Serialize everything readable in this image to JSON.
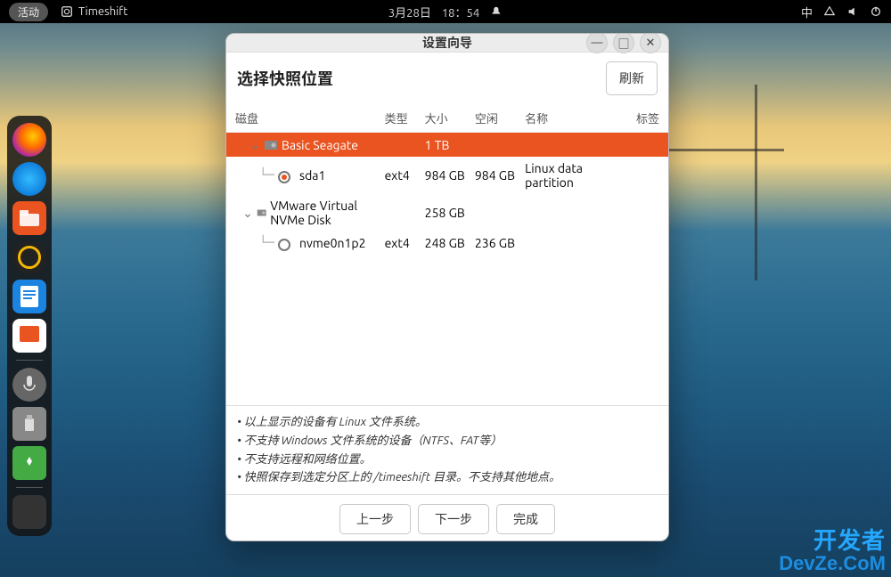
{
  "topbar": {
    "activities": "活动",
    "app_name": "Timeshift",
    "date": "3月28日",
    "time": "18：54",
    "input_method": "中"
  },
  "dock": {
    "items": [
      {
        "name": "firefox"
      },
      {
        "name": "thunderbird"
      },
      {
        "name": "files"
      },
      {
        "name": "rhythmbox"
      },
      {
        "name": "libreoffice-writer"
      },
      {
        "name": "ubuntu-software"
      },
      {
        "name": "microphone"
      },
      {
        "name": "usb-drive"
      },
      {
        "name": "recycle"
      },
      {
        "name": "show-apps"
      }
    ]
  },
  "window": {
    "title": "设置向导",
    "heading": "选择快照位置",
    "refresh": "刷新",
    "columns": {
      "disk": "磁盘",
      "type": "类型",
      "size": "大小",
      "free": "空闲",
      "name": "名称",
      "label": "标签"
    },
    "rows": [
      {
        "kind": "parent",
        "selected": true,
        "expanded": true,
        "label": "Basic Seagate",
        "type": "",
        "size": "1 TB",
        "free": "",
        "name": ""
      },
      {
        "kind": "child",
        "radio": true,
        "label": "sda1",
        "type": "ext4",
        "size": "984 GB",
        "free": "984 GB",
        "name": "Linux data partition"
      },
      {
        "kind": "parent",
        "selected": false,
        "expanded": true,
        "label": "VMware Virtual NVMe Disk",
        "type": "",
        "size": "258 GB",
        "free": "",
        "name": ""
      },
      {
        "kind": "child",
        "radio": false,
        "label": "nvme0n1p2",
        "type": "ext4",
        "size": "248 GB",
        "free": "236 GB",
        "name": ""
      }
    ],
    "notes": [
      "以上显示的设备有 Linux 文件系统。",
      "不支持 Windows 文件系统的设备（NTFS、FAT等）",
      "不支持远程和网络位置。",
      "快照保存到选定分区上的 /timeeshift 目录。不支持其他地点。"
    ],
    "buttons": {
      "prev": "上一步",
      "next": "下一步",
      "finish": "完成"
    }
  },
  "watermark": {
    "line1": "开发者",
    "line2": "DevZe.CoM"
  }
}
